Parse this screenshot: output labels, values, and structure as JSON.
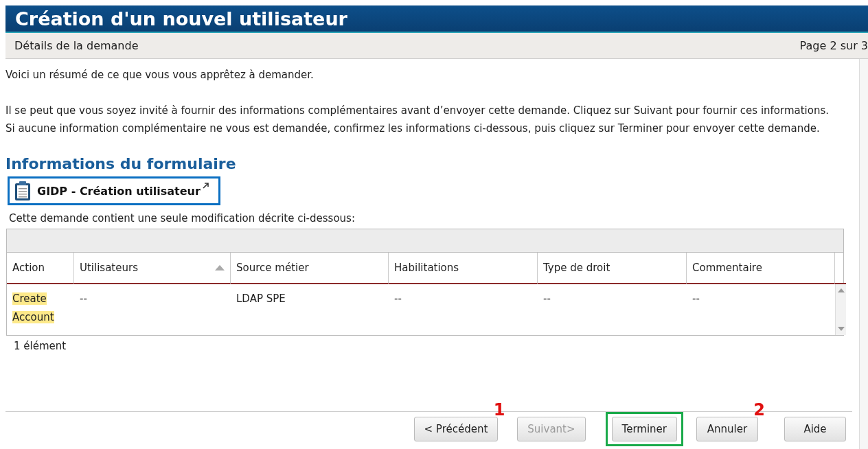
{
  "window": {
    "title": "Création d'un nouvel utilisateur"
  },
  "subheader": {
    "label": "Détails de la demande",
    "page": "Page 2 sur 3"
  },
  "intro": [
    "Voici un résumé de ce que vous vous apprêtez à demander.",
    "Il se peut que vous soyez invité à fournir des informations complémentaires avant d’envoyer cette demande. Cliquez sur Suivant pour fournir ces informations.",
    "Si aucune information complémentaire ne vous est demandée, confirmez les informations ci-dessous, puis cliquez sur Terminer pour envoyer cette demande."
  ],
  "section": {
    "title": "Informations du formulaire",
    "form_link": {
      "label": "GIDP - Création utilisateur",
      "highlighted": true
    },
    "description": "Cette demande contient une seule modification décrite ci-dessous:"
  },
  "table": {
    "columns": [
      {
        "label": "Action",
        "sorted": false
      },
      {
        "label": "Utilisateurs",
        "sorted": true
      },
      {
        "label": "Source métier",
        "sorted": false
      },
      {
        "label": "Habilitations",
        "sorted": false
      },
      {
        "label": "Type de droit",
        "sorted": false
      },
      {
        "label": "Commentaire",
        "sorted": false
      }
    ],
    "rows": [
      {
        "cells": [
          {
            "text": "Create Account",
            "highlighted": true
          },
          {
            "text": "--",
            "highlighted": false
          },
          {
            "text": "LDAP SPE",
            "highlighted": false
          },
          {
            "text": "--",
            "highlighted": false
          },
          {
            "text": "--",
            "highlighted": false
          },
          {
            "text": "--",
            "highlighted": false
          }
        ]
      }
    ],
    "count": "1 élément"
  },
  "buttons": [
    {
      "label": "< Précédent",
      "disabled": false,
      "highlighted": false,
      "marker": "1"
    },
    {
      "label": "Suivant>",
      "disabled": true,
      "highlighted": false
    },
    {
      "label": "Terminer",
      "disabled": false,
      "highlighted": true
    },
    {
      "label": "Annuler",
      "disabled": false,
      "highlighted": false,
      "marker": "2"
    },
    {
      "label": "Aide",
      "disabled": false,
      "highlighted": false
    }
  ]
}
